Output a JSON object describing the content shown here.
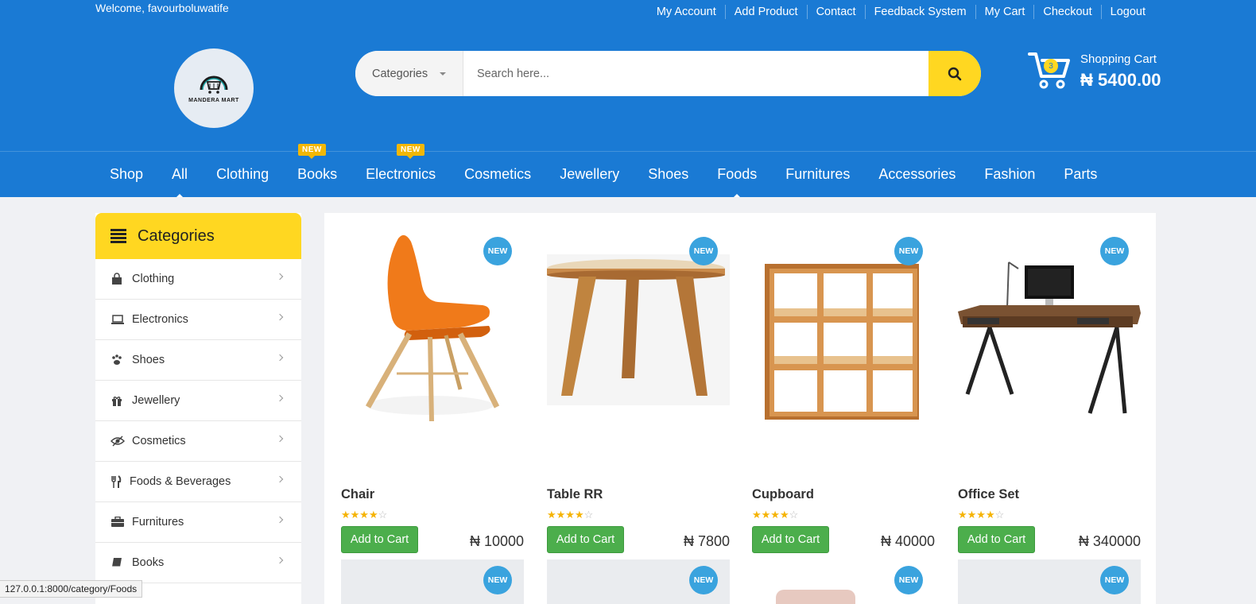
{
  "header": {
    "welcome": "Welcome, favourboluwatife",
    "top_links": [
      "My Account",
      "Add Product",
      "Contact",
      "Feedback System",
      "My Cart",
      "Checkout",
      "Logout"
    ],
    "logo_text": "MANDERA MART",
    "search": {
      "category_label": "Categories",
      "placeholder": "Search here..."
    },
    "cart": {
      "count": "3",
      "label": "Shopping Cart",
      "total": "₦ 5400.00"
    }
  },
  "nav": {
    "items": [
      "Shop",
      "All",
      "Clothing",
      "Books",
      "Electronics",
      "Cosmetics",
      "Jewellery",
      "Shoes",
      "Foods",
      "Furnitures",
      "Accessories",
      "Fashion",
      "Parts"
    ],
    "new_badge": "NEW",
    "new_badge_items": [
      "Books",
      "Electronics"
    ],
    "active_markers": [
      "All",
      "Foods"
    ]
  },
  "sidebar": {
    "title": "Categories",
    "items": [
      {
        "label": "Clothing",
        "icon": "shopping-bag-icon"
      },
      {
        "label": "Electronics",
        "icon": "laptop-icon"
      },
      {
        "label": "Shoes",
        "icon": "paw-icon"
      },
      {
        "label": "Jewellery",
        "icon": "gift-icon"
      },
      {
        "label": "Cosmetics",
        "icon": "eye-slash-icon"
      },
      {
        "label": "Foods & Beverages",
        "icon": "cutlery-icon"
      },
      {
        "label": "Furnitures",
        "icon": "briefcase-icon"
      },
      {
        "label": "Books",
        "icon": "book-icon"
      }
    ]
  },
  "products": {
    "new_label": "NEW",
    "add_to_cart": "Add to Cart",
    "items": [
      {
        "name": "Chair",
        "price": "₦ 10000",
        "rating": 4,
        "image": "orange-chair"
      },
      {
        "name": "Table RR",
        "price": "₦ 7800",
        "rating": 4,
        "image": "round-wooden-table"
      },
      {
        "name": "Cupboard",
        "price": "₦ 40000",
        "rating": 4,
        "image": "wooden-cube-shelf"
      },
      {
        "name": "Office Set",
        "price": "₦ 340000",
        "rating": 4,
        "image": "desk-with-computer"
      }
    ]
  },
  "status_bar": {
    "url": "127.0.0.1:8000/category/Foods"
  },
  "colors": {
    "brand_blue": "#1a7ad4",
    "accent_yellow": "#ffd721",
    "badge_blue": "#3aa3de",
    "button_green": "#4cae4c"
  }
}
